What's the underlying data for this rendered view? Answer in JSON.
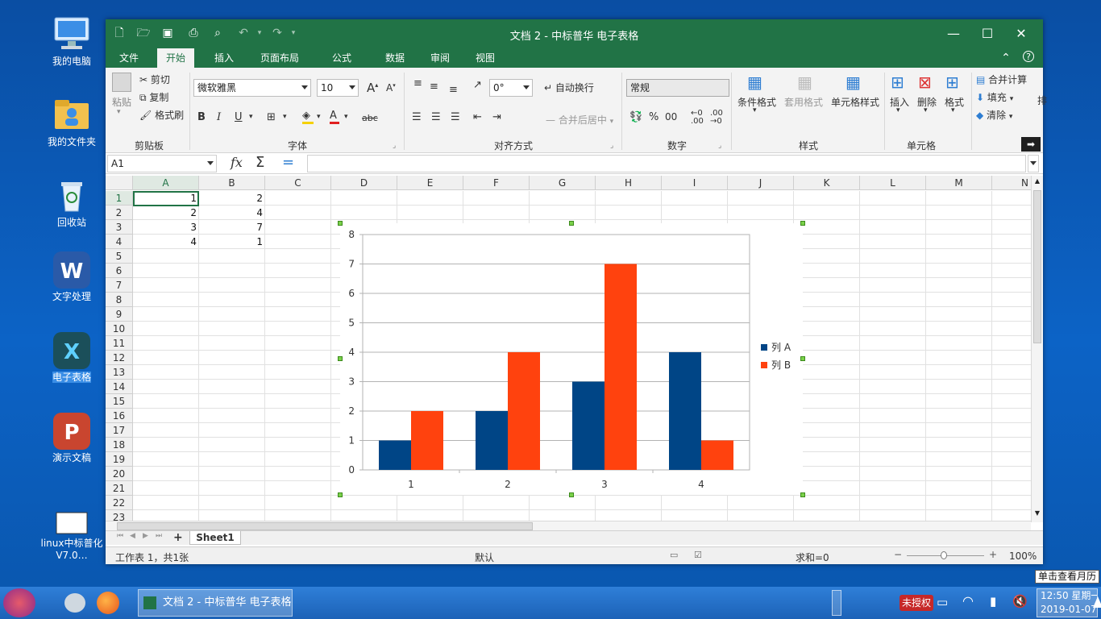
{
  "desktop": {
    "icons": [
      {
        "label": "我的电脑"
      },
      {
        "label": "我的文件夹"
      },
      {
        "label": "回收站"
      },
      {
        "label": "文字处理"
      },
      {
        "label": "电子表格"
      },
      {
        "label": "演示文稿"
      },
      {
        "label": "linux中标普化V7.0…"
      }
    ]
  },
  "window": {
    "title": "文档 2 - 中标普华 电子表格",
    "tabs": [
      "文件",
      "开始",
      "插入",
      "页面布局",
      "公式",
      "数据",
      "审阅",
      "视图"
    ],
    "active_tab": "开始"
  },
  "ribbon": {
    "clipboard": {
      "paste": "粘贴",
      "cut": "剪切",
      "copy": "复制",
      "format_painter": "格式刷",
      "label": "剪贴板"
    },
    "font": {
      "name": "微软雅黑",
      "size": "10",
      "label": "字体",
      "strike": "abc"
    },
    "align": {
      "rotation": "0°",
      "wrap": "自动换行",
      "merge": "合并后居中",
      "label": "对齐方式"
    },
    "number": {
      "format": "常规",
      "label": "数字"
    },
    "styles": {
      "cond": "条件格式",
      "table": "套用格式",
      "cell": "单元格样式",
      "label": "样式"
    },
    "cells": {
      "insert": "插入",
      "delete": "删除",
      "format": "格式",
      "label": "单元格"
    },
    "edit": {
      "sum": "合并计算",
      "fill": "填充",
      "clear": "清除",
      "extra": "排"
    }
  },
  "formula_bar": {
    "name_box": "A1",
    "formula": ""
  },
  "sheet": {
    "columns": [
      "A",
      "B",
      "C",
      "D",
      "E",
      "F",
      "G",
      "H",
      "I",
      "J",
      "K",
      "L",
      "M",
      "N"
    ],
    "rows": [
      "1",
      "2",
      "3",
      "4",
      "5",
      "6",
      "7",
      "8",
      "9",
      "10",
      "11",
      "12",
      "13",
      "14",
      "15",
      "16",
      "17",
      "18",
      "19",
      "20",
      "21",
      "22",
      "23"
    ],
    "cells": {
      "A": [
        "1",
        "2",
        "3",
        "4"
      ],
      "B": [
        "2",
        "4",
        "7",
        "1"
      ]
    },
    "tab": "Sheet1",
    "add_tab": "+"
  },
  "chart_data": {
    "type": "bar",
    "categories": [
      "1",
      "2",
      "3",
      "4"
    ],
    "series": [
      {
        "name": "列 A",
        "values": [
          1,
          2,
          3,
          4
        ],
        "color": "#004586"
      },
      {
        "name": "列 B",
        "values": [
          2,
          4,
          7,
          1
        ],
        "color": "#ff420e"
      }
    ],
    "ylim": [
      0,
      8
    ],
    "yticks": [
      "0",
      "1",
      "2",
      "3",
      "4",
      "5",
      "6",
      "7",
      "8"
    ],
    "grid": true,
    "legend": "right"
  },
  "status": {
    "sheet_info": "工作表 1，共1张",
    "style": "默认",
    "sum": "求和=0",
    "zoom": "100%"
  },
  "taskbar": {
    "window_btn": "文档 2 - 中标普华 电子表格",
    "license": "未授权",
    "time": "12:50 星期一",
    "date": "2019-01-07",
    "tooltip": "单击查看月历"
  },
  "colors": {
    "accent": "#217346"
  }
}
